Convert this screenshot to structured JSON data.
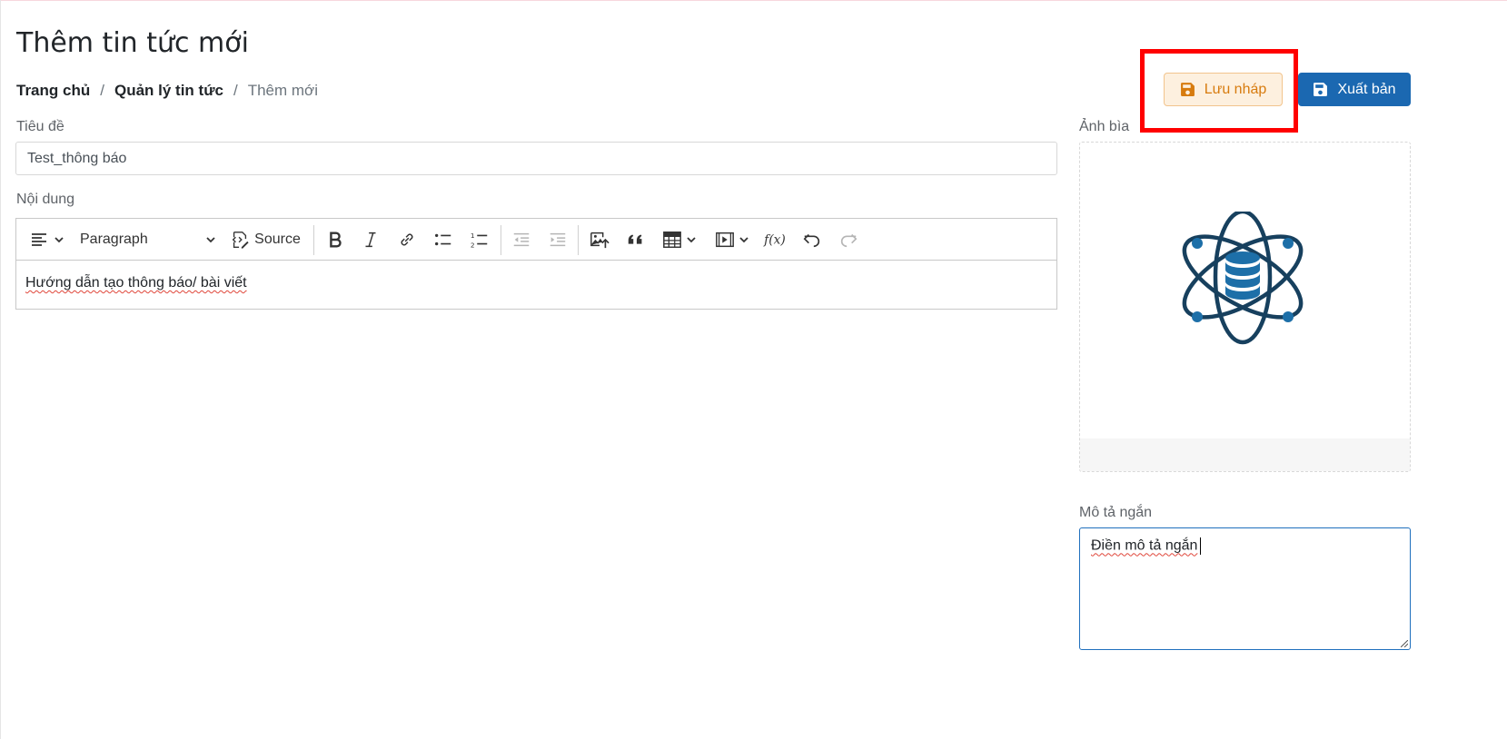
{
  "page": {
    "title": "Thêm tin tức mới"
  },
  "breadcrumb": {
    "items": [
      "Trang chủ",
      "Quản lý tin tức",
      "Thêm mới"
    ],
    "separator": "/"
  },
  "actions": {
    "draft_label": "Lưu nháp",
    "publish_label": "Xuất bản",
    "draft_icon": "floppy-disk-icon",
    "publish_icon": "floppy-disk-icon"
  },
  "form": {
    "title_label": "Tiêu đề",
    "title_value": "Test_thông báo",
    "content_label": "Nội dung",
    "content_text": "Hướng dẫn tạo thông báo/ bài viết",
    "cover_label": "Ảnh bìa",
    "cover_icon": "atom-database-icon",
    "short_desc_label": "Mô tả ngắn",
    "short_desc_value": "Điền mô tả ngắn"
  },
  "editor_toolbar": {
    "heading_select": "Paragraph",
    "source_label": "Source",
    "items": [
      "align-icon",
      "paragraph-select",
      "source-icon",
      "bold-icon",
      "italic-icon",
      "link-icon",
      "bulleted-list-icon",
      "numbered-list-icon",
      "outdent-icon",
      "indent-icon",
      "insert-image-icon",
      "blockquote-icon",
      "table-icon",
      "media-icon",
      "math-formula-icon",
      "undo-icon",
      "redo-icon"
    ]
  },
  "colors": {
    "draft_bg": "#fdf0df",
    "draft_text": "#d77b0e",
    "publish_bg": "#1b68b1",
    "highlight": "#ff0000",
    "icon_blue": "#1d6fa8",
    "icon_dark": "#17405e"
  }
}
